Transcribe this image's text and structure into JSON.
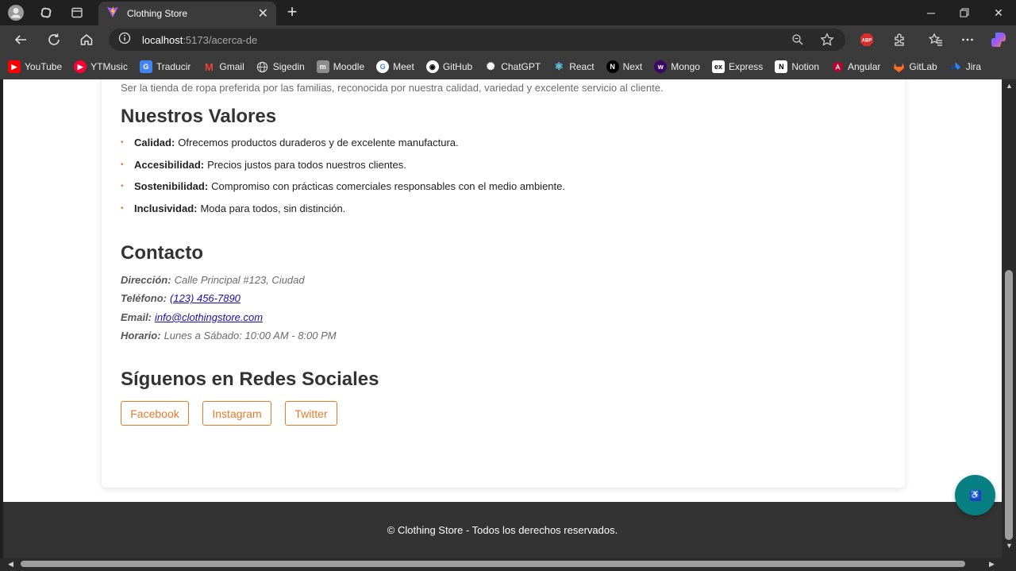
{
  "browser": {
    "tab_title": "Clothing Store",
    "url_host": "localhost",
    "url_path": ":5173/acerca-de",
    "bookmarks": [
      {
        "label": "YouTube",
        "icon": "youtube-icon",
        "color": "#ff0000"
      },
      {
        "label": "YTMusic",
        "icon": "ytmusic-icon",
        "color": "#ff0033"
      },
      {
        "label": "Traducir",
        "icon": "translate-icon",
        "color": "#4285f4"
      },
      {
        "label": "Gmail",
        "icon": "gmail-icon",
        "color": "#ea4335"
      },
      {
        "label": "Sigedin",
        "icon": "globe-icon",
        "color": "#5f6368"
      },
      {
        "label": "Moodle",
        "icon": "moodle-icon",
        "color": "#9a9a9a"
      },
      {
        "label": "Meet",
        "icon": "google-icon",
        "color": "#ffffff"
      },
      {
        "label": "GitHub",
        "icon": "github-icon",
        "color": "#ffffff"
      },
      {
        "label": "ChatGPT",
        "icon": "chatgpt-icon",
        "color": "#ffffff"
      },
      {
        "label": "React",
        "icon": "react-icon",
        "color": "#61dafb"
      },
      {
        "label": "Next",
        "icon": "next-icon",
        "color": "#000000"
      },
      {
        "label": "Mongo",
        "icon": "mongo-icon",
        "color": "#6b21a8"
      },
      {
        "label": "Express",
        "icon": "express-icon",
        "color": "#ffffff"
      },
      {
        "label": "Notion",
        "icon": "notion-icon",
        "color": "#ffffff"
      },
      {
        "label": "Angular",
        "icon": "angular-icon",
        "color": "#dd0031"
      },
      {
        "label": "GitLab",
        "icon": "gitlab-icon",
        "color": "#fc6d26"
      },
      {
        "label": "Jira",
        "icon": "jira-icon",
        "color": "#2684ff"
      }
    ]
  },
  "page": {
    "vision_text": "Ser la tienda de ropa preferida por las familias, reconocida por nuestra calidad, variedad y excelente servicio al cliente.",
    "values_title": "Nuestros Valores",
    "values": [
      {
        "term": "Calidad:",
        "desc": "Ofrecemos productos duraderos y de excelente manufactura."
      },
      {
        "term": "Accesibilidad:",
        "desc": "Precios justos para todos nuestros clientes."
      },
      {
        "term": "Sostenibilidad:",
        "desc": "Compromiso con prácticas comerciales responsables con el medio ambiente."
      },
      {
        "term": "Inclusividad:",
        "desc": "Moda para todos, sin distinción."
      }
    ],
    "contact_title": "Contacto",
    "contact": {
      "address_label": "Dirección:",
      "address": "Calle Principal #123, Ciudad",
      "phone_label": "Teléfono:",
      "phone": "(123) 456-7890",
      "email_label": "Email:",
      "email": "info@clothingstore.com",
      "hours_label": "Horario:",
      "hours": "Lunes a Sábado: 10:00 AM - 8:00 PM"
    },
    "social_title": "Síguenos en Redes Sociales",
    "social_buttons": [
      "Facebook",
      "Instagram",
      "Twitter"
    ],
    "footer": "© Clothing Store - Todos los derechos reservados.",
    "accent_color": "#e8792b"
  }
}
